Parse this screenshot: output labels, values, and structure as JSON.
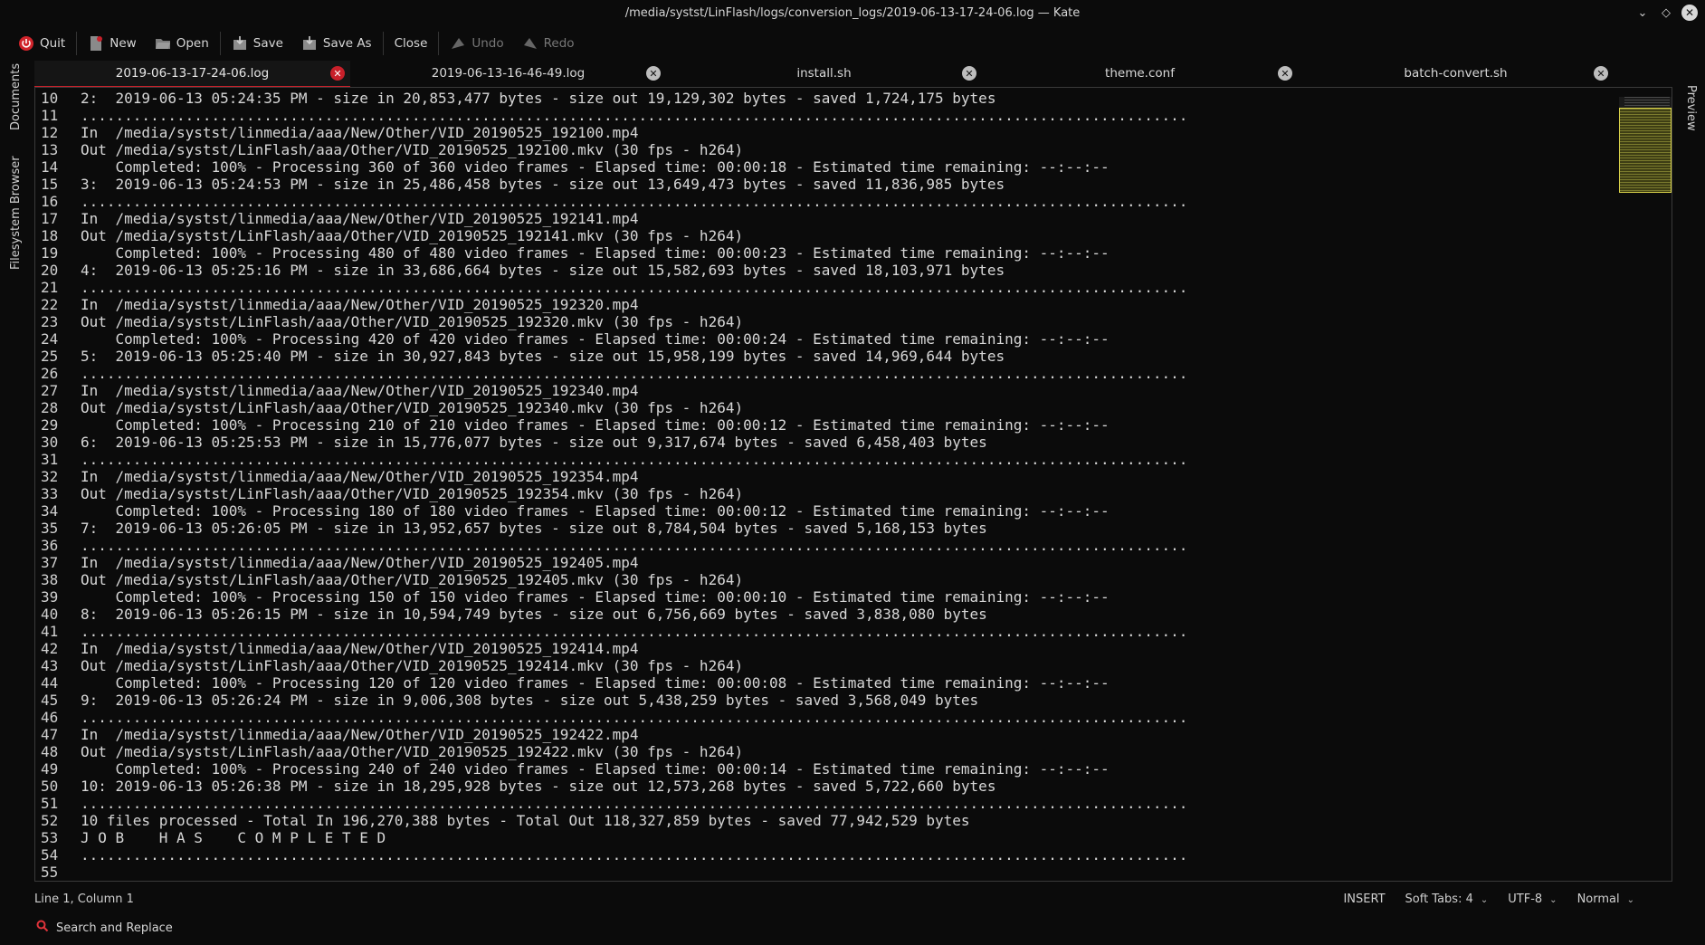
{
  "window": {
    "title": "/media/systst/LinFlash/logs/conversion_logs/2019-06-13-17-24-06.log — Kate"
  },
  "toolbar": {
    "quit": "Quit",
    "new": "New",
    "open": "Open",
    "save": "Save",
    "save_as": "Save As",
    "close": "Close",
    "undo": "Undo",
    "redo": "Redo"
  },
  "side_panels": {
    "documents": "Documents",
    "filesystem_browser": "Filesystem Browser",
    "preview": "Preview"
  },
  "tabs": [
    {
      "label": "2019-06-13-17-24-06.log",
      "active": true
    },
    {
      "label": "2019-06-13-16-46-49.log",
      "active": false
    },
    {
      "label": "install.sh",
      "active": false
    },
    {
      "label": "theme.conf",
      "active": false
    },
    {
      "label": "batch-convert.sh",
      "active": false
    }
  ],
  "editor": {
    "lines": [
      {
        "n": "10",
        "text": "2:  2019-06-13 05:24:35 PM - size in 20,853,477 bytes - size out 19,129,302 bytes - saved 1,724,175 bytes"
      },
      {
        "n": "11",
        "text": "..............................................................................................................................."
      },
      {
        "n": "12",
        "text": "In  /media/systst/linmedia/aaa/New/Other/VID_20190525_192100.mp4"
      },
      {
        "n": "13",
        "text": "Out /media/systst/LinFlash/aaa/Other/VID_20190525_192100.mkv (30 fps - h264)"
      },
      {
        "n": "14",
        "text": "    Completed: 100% - Processing 360 of 360 video frames - Elapsed time: 00:00:18 - Estimated time remaining: --:--:--"
      },
      {
        "n": "15",
        "text": "3:  2019-06-13 05:24:53 PM - size in 25,486,458 bytes - size out 13,649,473 bytes - saved 11,836,985 bytes"
      },
      {
        "n": "16",
        "text": "..............................................................................................................................."
      },
      {
        "n": "17",
        "text": "In  /media/systst/linmedia/aaa/New/Other/VID_20190525_192141.mp4"
      },
      {
        "n": "18",
        "text": "Out /media/systst/LinFlash/aaa/Other/VID_20190525_192141.mkv (30 fps - h264)"
      },
      {
        "n": "19",
        "text": "    Completed: 100% - Processing 480 of 480 video frames - Elapsed time: 00:00:23 - Estimated time remaining: --:--:--"
      },
      {
        "n": "20",
        "text": "4:  2019-06-13 05:25:16 PM - size in 33,686,664 bytes - size out 15,582,693 bytes - saved 18,103,971 bytes"
      },
      {
        "n": "21",
        "text": "..............................................................................................................................."
      },
      {
        "n": "22",
        "text": "In  /media/systst/linmedia/aaa/New/Other/VID_20190525_192320.mp4"
      },
      {
        "n": "23",
        "text": "Out /media/systst/LinFlash/aaa/Other/VID_20190525_192320.mkv (30 fps - h264)"
      },
      {
        "n": "24",
        "text": "    Completed: 100% - Processing 420 of 420 video frames - Elapsed time: 00:00:24 - Estimated time remaining: --:--:--"
      },
      {
        "n": "25",
        "text": "5:  2019-06-13 05:25:40 PM - size in 30,927,843 bytes - size out 15,958,199 bytes - saved 14,969,644 bytes"
      },
      {
        "n": "26",
        "text": "..............................................................................................................................."
      },
      {
        "n": "27",
        "text": "In  /media/systst/linmedia/aaa/New/Other/VID_20190525_192340.mp4"
      },
      {
        "n": "28",
        "text": "Out /media/systst/LinFlash/aaa/Other/VID_20190525_192340.mkv (30 fps - h264)"
      },
      {
        "n": "29",
        "text": "    Completed: 100% - Processing 210 of 210 video frames - Elapsed time: 00:00:12 - Estimated time remaining: --:--:--"
      },
      {
        "n": "30",
        "text": "6:  2019-06-13 05:25:53 PM - size in 15,776,077 bytes - size out 9,317,674 bytes - saved 6,458,403 bytes"
      },
      {
        "n": "31",
        "text": "..............................................................................................................................."
      },
      {
        "n": "32",
        "text": "In  /media/systst/linmedia/aaa/New/Other/VID_20190525_192354.mp4"
      },
      {
        "n": "33",
        "text": "Out /media/systst/LinFlash/aaa/Other/VID_20190525_192354.mkv (30 fps - h264)"
      },
      {
        "n": "34",
        "text": "    Completed: 100% - Processing 180 of 180 video frames - Elapsed time: 00:00:12 - Estimated time remaining: --:--:--"
      },
      {
        "n": "35",
        "text": "7:  2019-06-13 05:26:05 PM - size in 13,952,657 bytes - size out 8,784,504 bytes - saved 5,168,153 bytes"
      },
      {
        "n": "36",
        "text": "..............................................................................................................................."
      },
      {
        "n": "37",
        "text": "In  /media/systst/linmedia/aaa/New/Other/VID_20190525_192405.mp4"
      },
      {
        "n": "38",
        "text": "Out /media/systst/LinFlash/aaa/Other/VID_20190525_192405.mkv (30 fps - h264)"
      },
      {
        "n": "39",
        "text": "    Completed: 100% - Processing 150 of 150 video frames - Elapsed time: 00:00:10 - Estimated time remaining: --:--:--"
      },
      {
        "n": "40",
        "text": "8:  2019-06-13 05:26:15 PM - size in 10,594,749 bytes - size out 6,756,669 bytes - saved 3,838,080 bytes"
      },
      {
        "n": "41",
        "text": "..............................................................................................................................."
      },
      {
        "n": "42",
        "text": "In  /media/systst/linmedia/aaa/New/Other/VID_20190525_192414.mp4"
      },
      {
        "n": "43",
        "text": "Out /media/systst/LinFlash/aaa/Other/VID_20190525_192414.mkv (30 fps - h264)"
      },
      {
        "n": "44",
        "text": "    Completed: 100% - Processing 120 of 120 video frames - Elapsed time: 00:00:08 - Estimated time remaining: --:--:--"
      },
      {
        "n": "45",
        "text": "9:  2019-06-13 05:26:24 PM - size in 9,006,308 bytes - size out 5,438,259 bytes - saved 3,568,049 bytes"
      },
      {
        "n": "46",
        "text": "..............................................................................................................................."
      },
      {
        "n": "47",
        "text": "In  /media/systst/linmedia/aaa/New/Other/VID_20190525_192422.mp4"
      },
      {
        "n": "48",
        "text": "Out /media/systst/LinFlash/aaa/Other/VID_20190525_192422.mkv (30 fps - h264)"
      },
      {
        "n": "49",
        "text": "    Completed: 100% - Processing 240 of 240 video frames - Elapsed time: 00:00:14 - Estimated time remaining: --:--:--"
      },
      {
        "n": "50",
        "text": "10: 2019-06-13 05:26:38 PM - size in 18,295,928 bytes - size out 12,573,268 bytes - saved 5,722,660 bytes"
      },
      {
        "n": "51",
        "text": "..............................................................................................................................."
      },
      {
        "n": "52",
        "text": "10 files processed - Total In 196,270,388 bytes - Total Out 118,327,859 bytes - saved 77,942,529 bytes"
      },
      {
        "n": "53",
        "text": "J O B    H A S    C O M P L E T E D"
      },
      {
        "n": "54",
        "text": "..............................................................................................................................."
      },
      {
        "n": "55",
        "text": ""
      }
    ]
  },
  "statusbar": {
    "cursor": "Line 1, Column 1",
    "mode": "INSERT",
    "indent": "Soft Tabs: 4",
    "encoding": "UTF-8",
    "input_mode": "Normal"
  },
  "bottombar": {
    "search_replace": "Search and Replace"
  },
  "colors": {
    "accent_red": "#c8202a",
    "minimap_highlight": "#d9d24a"
  }
}
